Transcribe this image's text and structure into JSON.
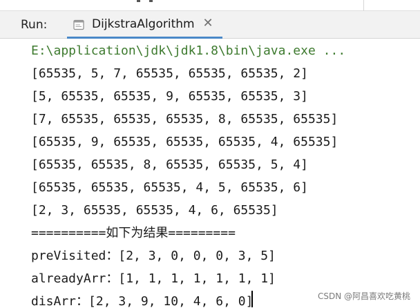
{
  "run_panel": {
    "label": "Run:",
    "tab": {
      "title": "DijkstraAlgorithm",
      "close_glyph": "✕",
      "icon": "console-window-icon"
    },
    "accent_color": "#4a88c7"
  },
  "console": {
    "command": "E:\\application\\jdk\\jdk1.8\\bin\\java.exe ...",
    "command_color": "#3d7a2e",
    "lines": [
      "[65535, 5, 7, 65535, 65535, 65535, 2]",
      "[5, 65535, 65535, 9, 65535, 65535, 3]",
      "[7, 65535, 65535, 65535, 8, 65535, 65535]",
      "[65535, 9, 65535, 65535, 65535, 4, 65535]",
      "[65535, 65535, 8, 65535, 65535, 5, 4]",
      "[65535, 65535, 65535, 4, 5, 65535, 6]",
      "[2, 3, 65535, 65535, 4, 6, 65535]",
      "==========如下为结果=========",
      "preVisited：[2, 3, 0, 0, 0, 3, 5]",
      "alreadyArr：[1, 1, 1, 1, 1, 1, 1]",
      "disArr：[2, 3, 9, 10, 4, 6, 0]"
    ]
  },
  "watermark": "CSDN @阿昌喜欢吃黄桃"
}
